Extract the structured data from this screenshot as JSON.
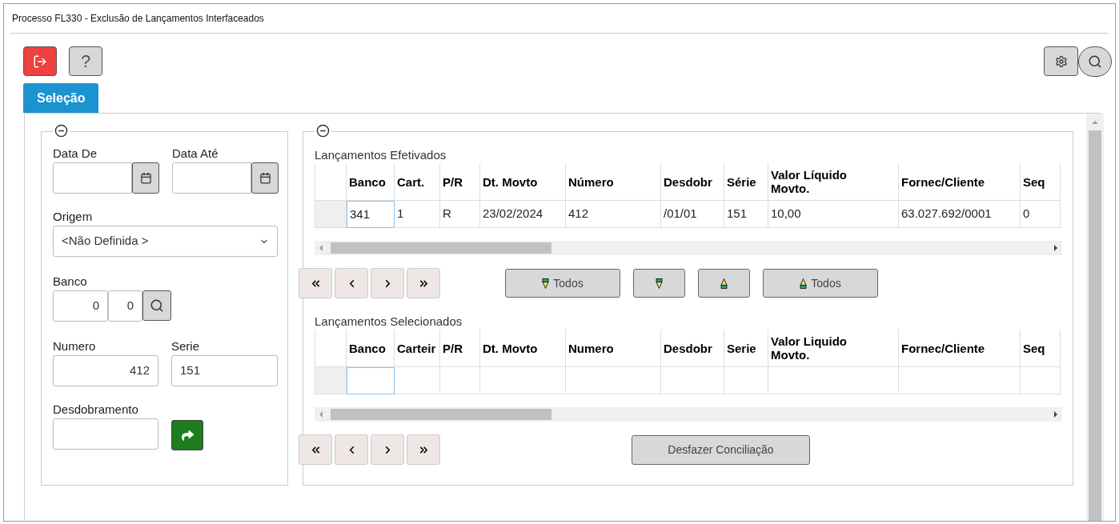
{
  "window": {
    "title": "Processo FL330 - Exclusão de Lançamentos Interfaceados"
  },
  "toolbar": {
    "help_label": "?"
  },
  "tabs": [
    {
      "label": "Seleção",
      "selected": true
    }
  ],
  "filters": {
    "data_de": {
      "label": "Data De"
    },
    "data_ate": {
      "label": "Data Até"
    },
    "origem": {
      "label": "Origem",
      "value": "<Não Definida >"
    },
    "banco": {
      "label": "Banco",
      "value_1": "0",
      "value_2": "0"
    },
    "numero": {
      "label": "Numero",
      "value": "412"
    },
    "serie": {
      "label": "Serie",
      "value": "151"
    },
    "desdobramento": {
      "label": "Desdobramento"
    }
  },
  "efetivados": {
    "title": "Lançamentos Efetivados",
    "columns": [
      "Banco",
      "Cart.",
      "P/R",
      "Dt. Movto",
      "Número",
      "Desdobr",
      "Série",
      "Valor Líquido Movto.",
      "Fornec/Cliente",
      "Seq"
    ],
    "rows": [
      {
        "cells": [
          {
            "text": "341",
            "focused": true
          },
          {
            "text": "1",
            "focused": false
          },
          {
            "text": "R",
            "focused": false
          },
          {
            "text": "23/02/2024",
            "focused": false
          },
          {
            "text": "412",
            "focused": false
          },
          {
            "text": "/01/01",
            "focused": false
          },
          {
            "text": "151",
            "focused": false
          },
          {
            "text": "10,00",
            "focused": false
          },
          {
            "text": "63.027.692/0001",
            "focused": false
          },
          {
            "text": "0",
            "focused": false
          }
        ]
      }
    ]
  },
  "actions": [
    {
      "kind": "down",
      "label": "Todos"
    },
    {
      "kind": "down"
    },
    {
      "kind": "up"
    },
    {
      "kind": "up",
      "label": "Todos"
    }
  ],
  "selecionados": {
    "title": "Lançamentos Selecionados",
    "columns": [
      "Banco",
      "Carteir",
      "P/R",
      "Dt. Movto",
      "Numero",
      "Desdobr",
      "Serie",
      "Valor Liquido Movto.",
      "Fornec/Cliente",
      "Seq"
    ],
    "rows": [
      {
        "cells": [
          {
            "focused": true
          },
          {
            "focused": false
          },
          {
            "focused": false
          },
          {
            "focused": false
          },
          {
            "focused": false
          },
          {
            "focused": false
          },
          {
            "focused": false
          },
          {
            "focused": false
          },
          {
            "focused": false
          },
          {
            "focused": false
          }
        ]
      }
    ]
  },
  "undo_button": "Desfazer Conciliação"
}
